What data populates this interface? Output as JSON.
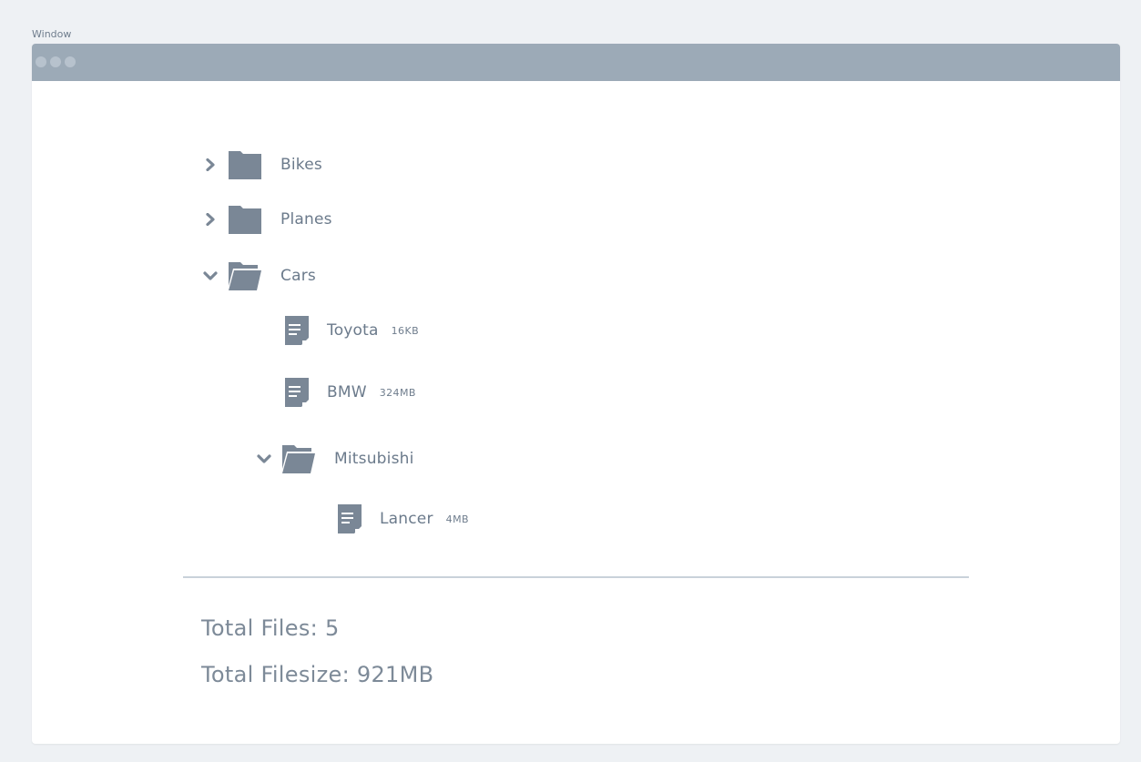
{
  "outer_label": "Window",
  "window": {
    "tree": {
      "items": [
        {
          "label": "Bikes",
          "type": "folder",
          "expanded": false
        },
        {
          "label": "Planes",
          "type": "folder",
          "expanded": false
        },
        {
          "label": "Cars",
          "type": "folder",
          "expanded": true,
          "children": [
            {
              "label": "Toyota",
              "type": "file",
              "size": "16KB"
            },
            {
              "label": "BMW",
              "type": "file",
              "size": "324MB"
            },
            {
              "label": "Mitsubishi",
              "type": "folder",
              "expanded": true,
              "children": [
                {
                  "label": "Lancer",
                  "type": "file",
                  "size": "4MB"
                }
              ]
            }
          ]
        }
      ]
    },
    "summary": {
      "total_files": "Total Files: 5",
      "total_filesize": "Total Filesize: 921MB"
    }
  },
  "colors": {
    "icon": "#7a8796",
    "titlebar": "#9caab7",
    "window_dots": "#b7c2cd"
  },
  "icons": {
    "collapsed": "chevron-right-icon",
    "expanded": "chevron-down-icon",
    "folder_closed": "folder-icon",
    "folder_open": "folder-open-icon",
    "file": "document-icon"
  }
}
